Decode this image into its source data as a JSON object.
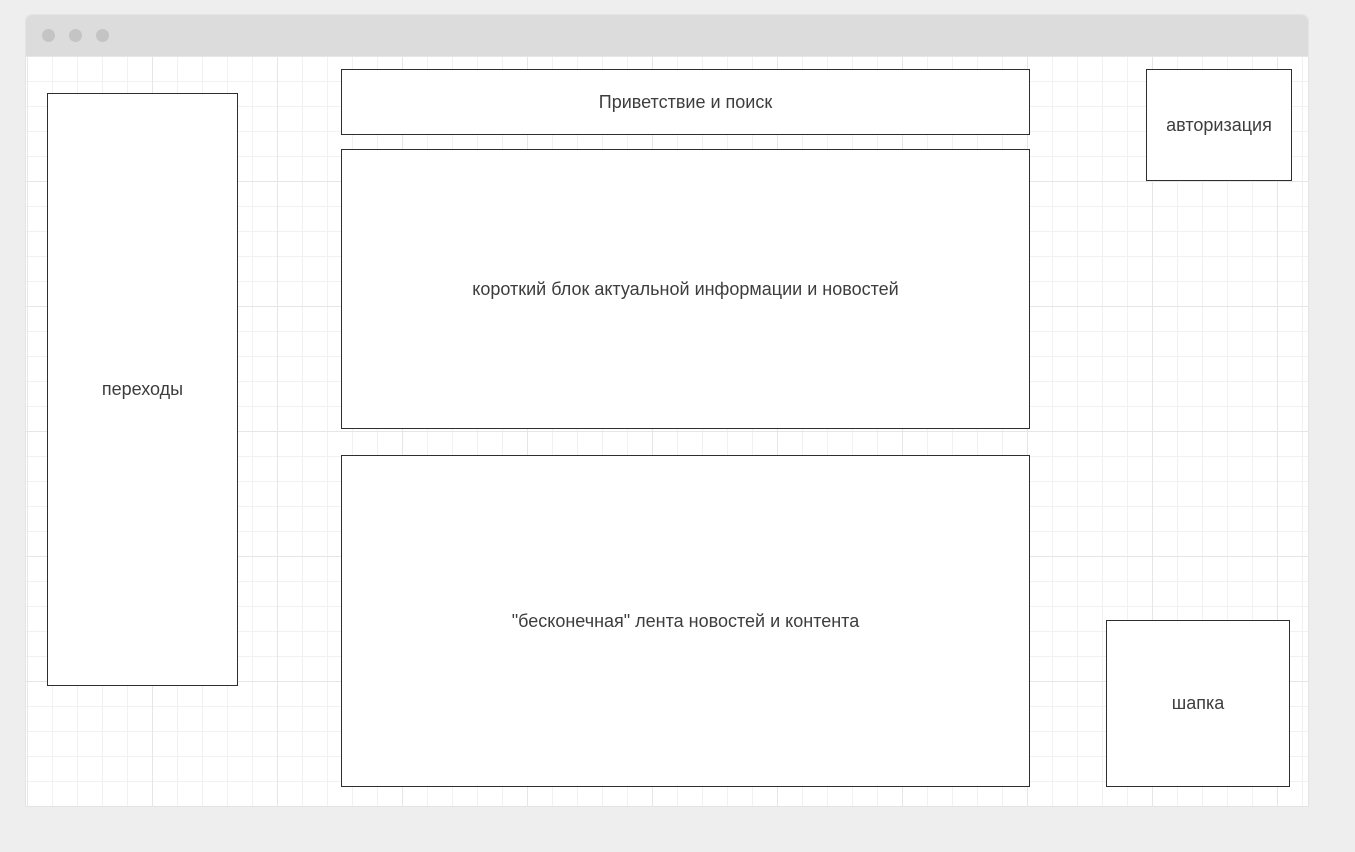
{
  "window": {
    "titlebar_buttons": [
      "close",
      "minimize",
      "maximize"
    ]
  },
  "blocks": {
    "navigation": "переходы",
    "greeting_search": "Приветствие и поиск",
    "news_short": "короткий блок актуальной информации и новостей",
    "feed": "\"бесконечная\" лента новостей и контента",
    "authorization": "авторизация",
    "header": "шапка"
  },
  "colors": {
    "page_background": "#eeeeee",
    "titlebar": "#dcdcdc",
    "window_dots": "#c4c4c4",
    "block_border": "#2e2e2e",
    "text": "#3d3d3d"
  }
}
